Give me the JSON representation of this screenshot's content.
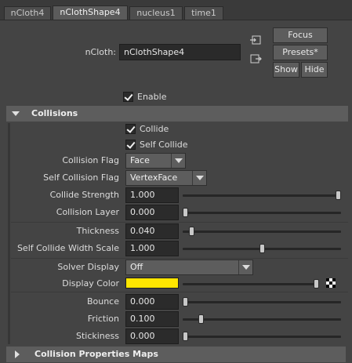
{
  "tabs": [
    {
      "label": "nCloth4"
    },
    {
      "label": "nClothShape4"
    },
    {
      "label": "nucleus1"
    },
    {
      "label": "time1"
    }
  ],
  "header": {
    "ncloth_label": "nCloth:",
    "ncloth_value": "nClothShape4",
    "focus_label": "Focus",
    "presets_label": "Presets*",
    "show_label": "Show",
    "hide_label": "Hide",
    "enable_label": "Enable"
  },
  "collisions": {
    "title": "Collisions",
    "collide_label": "Collide",
    "self_collide_label": "Self Collide",
    "collision_flag": {
      "label": "Collision Flag",
      "value": "Face"
    },
    "self_collision_flag": {
      "label": "Self Collision Flag",
      "value": "VertexFace"
    },
    "collide_strength": {
      "label": "Collide Strength",
      "value": "1.000",
      "fraction": 1.0
    },
    "collision_layer": {
      "label": "Collision Layer",
      "value": "0.000",
      "fraction": 0.0
    },
    "thickness": {
      "label": "Thickness",
      "value": "0.040",
      "fraction": 0.04
    },
    "self_collide_width_scale": {
      "label": "Self Collide Width Scale",
      "value": "1.000",
      "fraction": 0.5
    },
    "solver_display": {
      "label": "Solver Display",
      "value": "Off"
    },
    "display_color": {
      "label": "Display Color",
      "hex": "#ffe600",
      "fraction": 1.0
    },
    "bounce": {
      "label": "Bounce",
      "value": "0.000",
      "fraction": 0.0
    },
    "friction": {
      "label": "Friction",
      "value": "0.100",
      "fraction": 0.1
    },
    "stickiness": {
      "label": "Stickiness",
      "value": "0.000",
      "fraction": 0.0
    }
  },
  "collision_properties_maps": {
    "title": "Collision Properties Maps"
  }
}
